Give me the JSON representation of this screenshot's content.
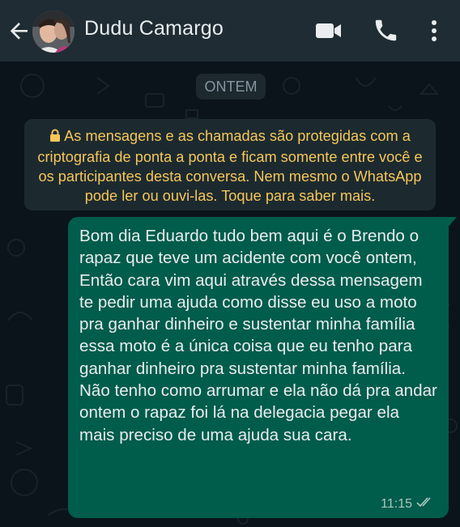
{
  "header": {
    "contact_name": "Dudu Camargo",
    "icons": [
      "back-arrow-icon",
      "avatar",
      "video-call-icon",
      "phone-icon",
      "more-options-icon"
    ]
  },
  "chat": {
    "date_label": "ONTEM",
    "system_message": "As mensagens e as chamadas são protegidas com a criptografia de ponta a ponta e ficam somente entre você e os participantes desta conversa. Nem mesmo o WhatsApp pode ler ou ouvi-las. Toque para saber mais.",
    "message": {
      "text": "Bom dia Eduardo tudo bem aqui é o Brendo o rapaz que teve um acidente com você ontem,\nEntão cara vim aqui através dessa mensagem te pedir uma ajuda como disse eu uso a moto pra ganhar dinheiro e sustentar minha família essa moto é a única coisa que eu tenho para ganhar dinheiro pra sustentar minha família.\nNão tenho como arrumar e ela não dá pra andar ontem o rapaz foi lá na delegacia pegar ela mais preciso de uma ajuda sua cara.",
      "time": "11:15",
      "status": "sent"
    }
  },
  "colors": {
    "header_bg": "#1f2c33",
    "chat_bg": "#0b141a",
    "outgoing_bubble": "#005c4b",
    "system_text": "#f7c65a",
    "system_bg": "#1c2a2f"
  }
}
